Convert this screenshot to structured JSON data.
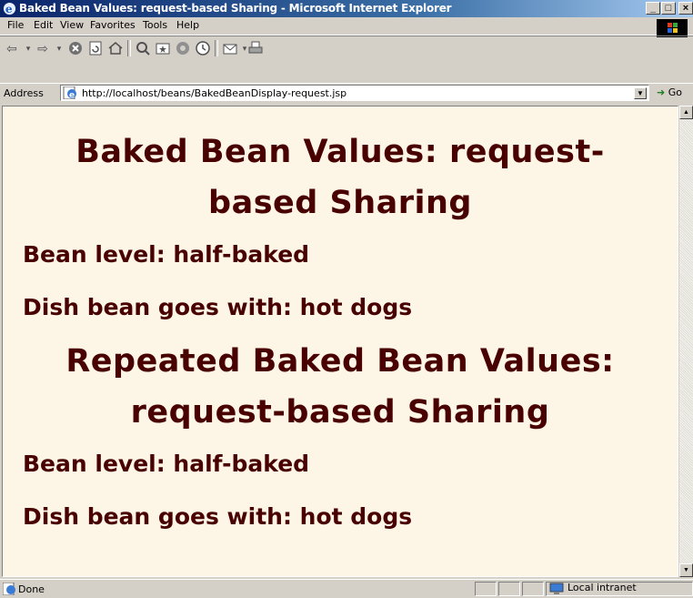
{
  "window": {
    "title": "Baked Bean Values: request-based Sharing - Microsoft Internet Explorer"
  },
  "menu": [
    "File",
    "Edit",
    "View",
    "Favorites",
    "Tools",
    "Help"
  ],
  "address": {
    "label": "Address",
    "url": "http://localhost/beans/BakedBeanDisplay-request.jsp",
    "go_label": "Go"
  },
  "page": {
    "heading1": "Baked Bean Values: request-based Sharing",
    "level1": "Bean level: half-baked",
    "dish1": "Dish bean goes with: hot dogs",
    "heading2": "Repeated Baked Bean Values: request-based Sharing",
    "level2": "Bean level: half-baked",
    "dish2": "Dish bean goes with: hot dogs"
  },
  "status": {
    "text": "Done",
    "zone": "Local intranet"
  },
  "colors": {
    "page_background": "#fdf5e6",
    "heading_text": "#480000"
  }
}
